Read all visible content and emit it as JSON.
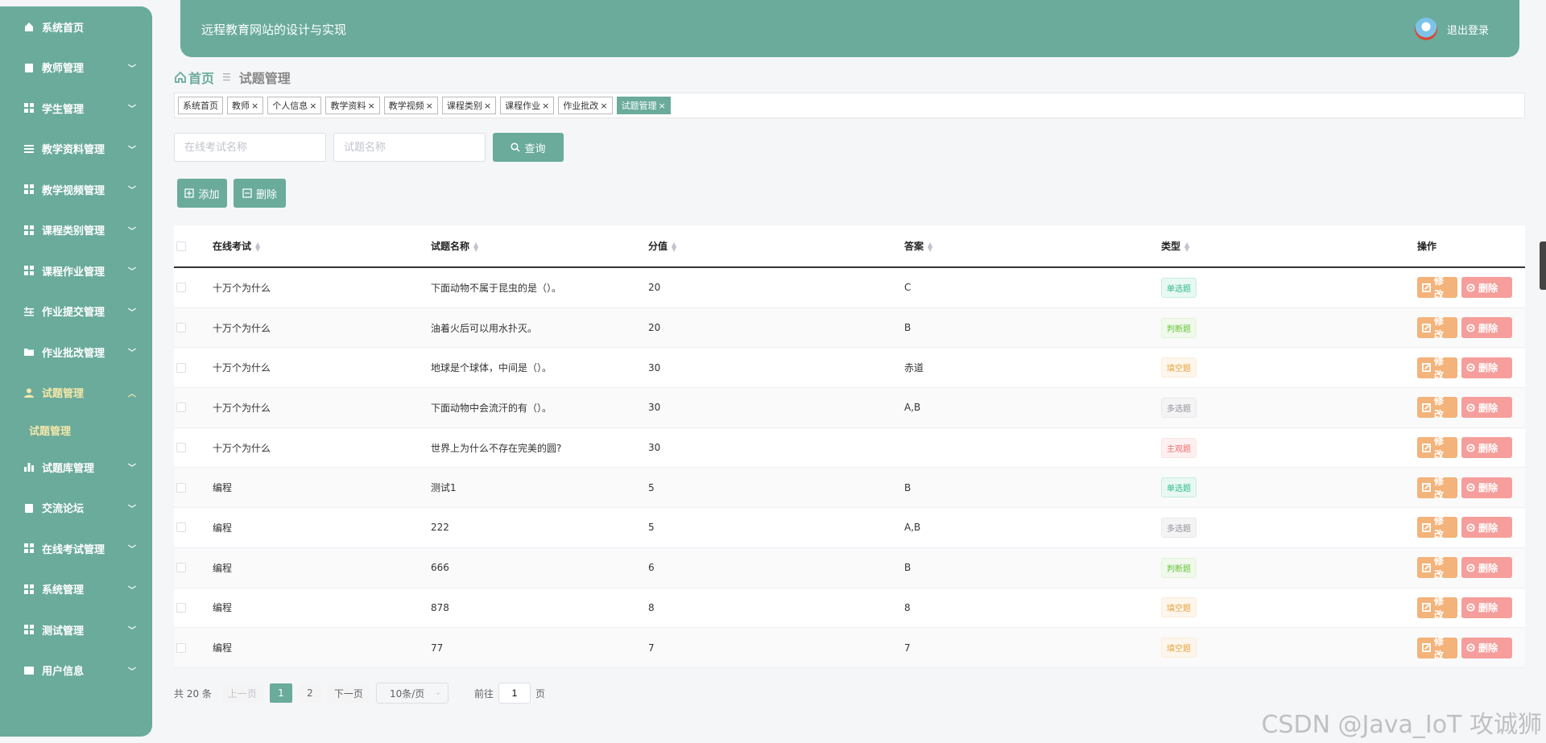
{
  "header": {
    "title": "远程教育网站的设计与实现",
    "logout": "退出登录"
  },
  "sidebar": {
    "items": [
      {
        "label": "系统首页",
        "icon": "home-icon",
        "has_chevron": false
      },
      {
        "label": "教师管理",
        "icon": "clipboard-icon",
        "has_chevron": true
      },
      {
        "label": "学生管理",
        "icon": "grid-icon",
        "has_chevron": true
      },
      {
        "label": "教学资料管理",
        "icon": "list-icon",
        "has_chevron": true
      },
      {
        "label": "教学视频管理",
        "icon": "grid-icon",
        "has_chevron": true
      },
      {
        "label": "课程类别管理",
        "icon": "grid-icon",
        "has_chevron": true
      },
      {
        "label": "课程作业管理",
        "icon": "grid-icon",
        "has_chevron": true
      },
      {
        "label": "作业提交管理",
        "icon": "sliders-icon",
        "has_chevron": true
      },
      {
        "label": "作业批改管理",
        "icon": "folder-icon",
        "has_chevron": true
      },
      {
        "label": "试题管理",
        "icon": "user-icon",
        "has_chevron": true,
        "active": true,
        "sub": "试题管理"
      },
      {
        "label": "试题库管理",
        "icon": "bar-chart-icon",
        "has_chevron": true
      },
      {
        "label": "交流论坛",
        "icon": "check-clipboard-icon",
        "has_chevron": true
      },
      {
        "label": "在线考试管理",
        "icon": "grid-icon",
        "has_chevron": true
      },
      {
        "label": "系统管理",
        "icon": "grid-icon",
        "has_chevron": true
      },
      {
        "label": "测试管理",
        "icon": "grid-icon",
        "has_chevron": true
      },
      {
        "label": "用户信息",
        "icon": "id-card-icon",
        "has_chevron": true
      }
    ]
  },
  "breadcrumb": {
    "home": "首页",
    "current": "试题管理"
  },
  "tags": [
    {
      "label": "系统首页",
      "closable": false
    },
    {
      "label": "教师",
      "closable": true
    },
    {
      "label": "个人信息",
      "closable": true
    },
    {
      "label": "教学资料",
      "closable": true
    },
    {
      "label": "教学视频",
      "closable": true
    },
    {
      "label": "课程类别",
      "closable": true
    },
    {
      "label": "课程作业",
      "closable": true
    },
    {
      "label": "作业批改",
      "closable": true
    },
    {
      "label": "试题管理",
      "closable": true,
      "active": true
    }
  ],
  "search": {
    "exam_placeholder": "在线考试名称",
    "question_placeholder": "试题名称",
    "query_label": "查询",
    "add_label": "添加",
    "delete_label": "删除"
  },
  "table": {
    "columns": [
      "在线考试",
      "试题名称",
      "分值",
      "答案",
      "类型",
      "操作"
    ],
    "edit_label": "修改",
    "delete_label": "删除",
    "rows": [
      {
        "exam": "十万个为什么",
        "question": "下面动物不属于昆虫的是（）。",
        "score": "20",
        "answer": "C",
        "type": "单选题",
        "type_style": "b-green"
      },
      {
        "exam": "十万个为什么",
        "question": "油着火后可以用水扑灭。",
        "score": "20",
        "answer": "B",
        "type": "判断题",
        "type_style": "b-lime"
      },
      {
        "exam": "十万个为什么",
        "question": "地球是个球体，中间是（）。",
        "score": "30",
        "answer": "赤道",
        "type": "填空题",
        "type_style": "b-orange"
      },
      {
        "exam": "十万个为什么",
        "question": "下面动物中会流汗的有（）。",
        "score": "30",
        "answer": "A,B",
        "type": "多选题",
        "type_style": "b-gray"
      },
      {
        "exam": "十万个为什么",
        "question": "世界上为什么不存在完美的圆?",
        "score": "30",
        "answer": "",
        "type": "主观题",
        "type_style": "b-red"
      },
      {
        "exam": "编程",
        "question": "测试1",
        "score": "5",
        "answer": "B",
        "type": "单选题",
        "type_style": "b-green"
      },
      {
        "exam": "编程",
        "question": "222",
        "score": "5",
        "answer": "A,B",
        "type": "多选题",
        "type_style": "b-gray"
      },
      {
        "exam": "编程",
        "question": "666",
        "score": "6",
        "answer": "B",
        "type": "判断题",
        "type_style": "b-lime"
      },
      {
        "exam": "编程",
        "question": "878",
        "score": "8",
        "answer": "8",
        "type": "填空题",
        "type_style": "b-orange"
      },
      {
        "exam": "编程",
        "question": "77",
        "score": "7",
        "answer": "7",
        "type": "填空题",
        "type_style": "b-orange"
      }
    ]
  },
  "pagination": {
    "total": "共 20 条",
    "prev": "上一页",
    "pages": [
      "1",
      "2"
    ],
    "current": "1",
    "next": "下一页",
    "page_size": "10条/页",
    "goto_prefix": "前往",
    "goto_value": "1",
    "goto_suffix": "页"
  },
  "watermark": "CSDN @Java_IoT 攻诚狮",
  "colors": {
    "primary": "#6aab9c",
    "edit": "#f3b37a",
    "delete": "#f59e9b",
    "active_menu": "#f5e7a8"
  }
}
